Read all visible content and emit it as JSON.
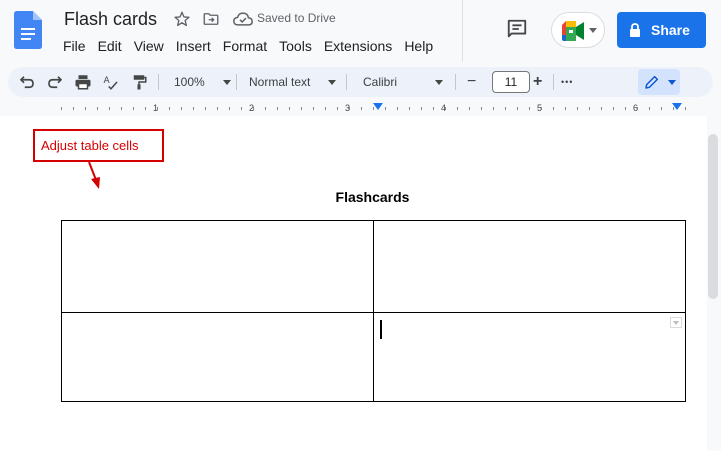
{
  "header": {
    "doc_title": "Flash cards",
    "save_status": "Saved to Drive",
    "share_label": "Share",
    "menu": [
      "File",
      "Edit",
      "View",
      "Insert",
      "Format",
      "Tools",
      "Extensions",
      "Help"
    ],
    "icons": [
      "docs-icon",
      "star-icon",
      "move-icon",
      "cloud-icon",
      "comment-icon",
      "meet-icon",
      "lock-icon"
    ],
    "share_color": "#1a73e8"
  },
  "toolbar": {
    "zoom": "100%",
    "style": "Normal text",
    "font": "Calibri",
    "font_size": "11",
    "minus": "−",
    "plus": "+",
    "more": "•••"
  },
  "ruler": {
    "numbers": [
      "1",
      "2",
      "3",
      "4",
      "5",
      "6"
    ]
  },
  "document": {
    "annotation": "Adjust table cells",
    "annotation_color": "#d50000",
    "heading": "Flashcards",
    "table": {
      "rows": 2,
      "cols": 2,
      "cells": [
        [
          "",
          ""
        ],
        [
          "",
          ""
        ]
      ]
    }
  }
}
